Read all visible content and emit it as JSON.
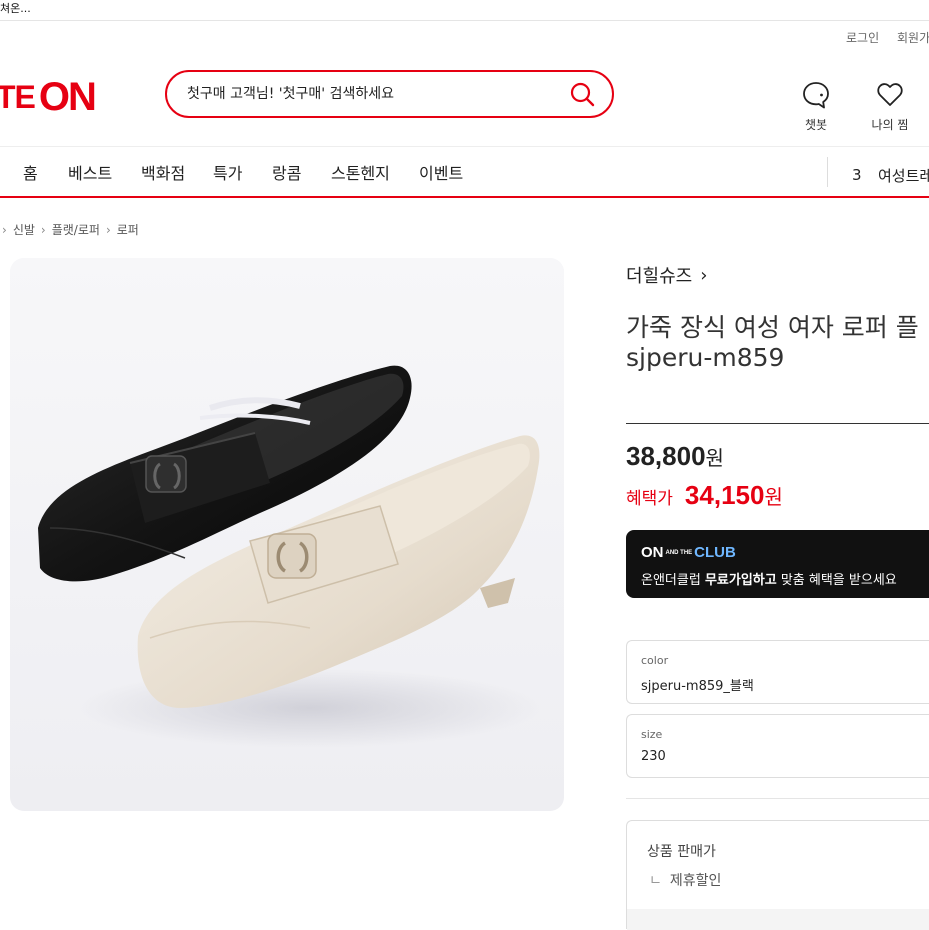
{
  "loading_text": "쳐온...",
  "utility": {
    "login": "로그인",
    "signup": "회원가"
  },
  "logo": {
    "left_part": "TE",
    "right_part": "ON"
  },
  "search": {
    "placeholder": "첫구매 고객님! '첫구매' 검색하세요"
  },
  "header_icons": [
    {
      "icon": "chat-bubble-icon",
      "label": "챗봇"
    },
    {
      "icon": "heart-icon",
      "label": "나의 찜"
    }
  ],
  "gnb": [
    "홈",
    "베스트",
    "백화점",
    "특가",
    "랑콤",
    "스톤헨지",
    "이벤트"
  ],
  "ranking": {
    "number": "3",
    "text": "여성트레"
  },
  "breadcrumb": [
    "",
    "신발",
    "플랫/로퍼",
    "로퍼"
  ],
  "product": {
    "brand": "더힐슈즈",
    "title_line1": "가죽 장식 여성 여자 로퍼 플",
    "title_line2": "sjperu-m859",
    "price": "38,800",
    "price_unit": "원",
    "benefit_label": "혜택가",
    "benefit_price": "34,150",
    "benefit_unit": "원"
  },
  "club": {
    "logo_on": "ON",
    "logo_and": "AND THE",
    "logo_club": "CLUB",
    "text_before": "온앤더클럽 ",
    "text_bold": "무료가입하고",
    "text_after": " 맞춤 혜택을 받으세요"
  },
  "options": [
    {
      "label": "color",
      "value": "sjperu-m859_블랙"
    },
    {
      "label": "size",
      "value": "230"
    }
  ],
  "seller": {
    "title": "상품 판매가",
    "sub_corner": "ㄴ",
    "sub": "제휴할인"
  },
  "colors": {
    "brand_red": "#e60012",
    "club_bg": "#111111",
    "club_accent": "#6fb7ff"
  }
}
